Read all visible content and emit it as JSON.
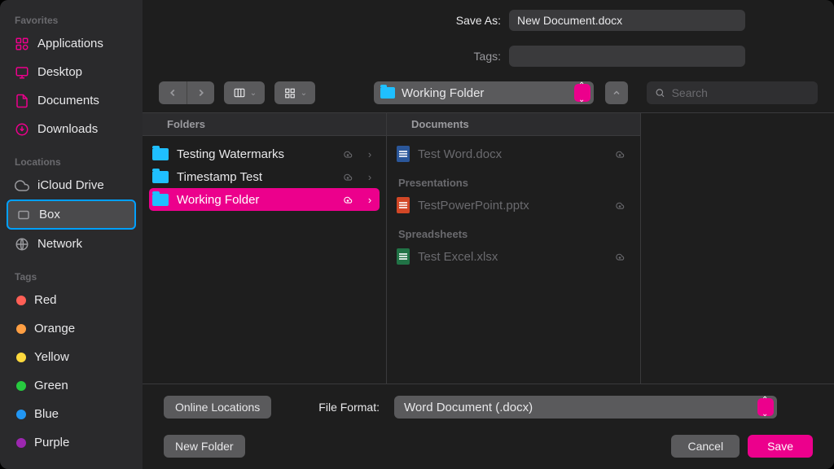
{
  "header": {
    "save_as_label": "Save As:",
    "filename": "New Document.docx",
    "tags_label": "Tags:",
    "tags_value": ""
  },
  "toolbar": {
    "location_folder": "Working Folder",
    "search_placeholder": "Search"
  },
  "sidebar": {
    "favorites_heading": "Favorites",
    "favorites": [
      {
        "label": "Applications",
        "icon": "apps"
      },
      {
        "label": "Desktop",
        "icon": "desktop"
      },
      {
        "label": "Documents",
        "icon": "document"
      },
      {
        "label": "Downloads",
        "icon": "download"
      }
    ],
    "locations_heading": "Locations",
    "locations": [
      {
        "label": "iCloud Drive",
        "icon": "cloud"
      },
      {
        "label": "Box",
        "icon": "box",
        "selected": true
      },
      {
        "label": "Network",
        "icon": "globe"
      }
    ],
    "tags_heading": "Tags",
    "tags": [
      {
        "label": "Red",
        "color": "#ff5f56"
      },
      {
        "label": "Orange",
        "color": "#ff9f43"
      },
      {
        "label": "Yellow",
        "color": "#ffd93d"
      },
      {
        "label": "Green",
        "color": "#27c93f"
      },
      {
        "label": "Blue",
        "color": "#2196f3"
      },
      {
        "label": "Purple",
        "color": "#9c27b0"
      }
    ]
  },
  "browser": {
    "col_a_heading": "Folders",
    "col_b_docs_heading": "Documents",
    "col_b_pres_heading": "Presentations",
    "col_b_spread_heading": "Spreadsheets",
    "folders": [
      {
        "label": "Testing Watermarks"
      },
      {
        "label": "Timestamp Test"
      },
      {
        "label": "Working Folder",
        "selected": true
      }
    ],
    "documents": [
      {
        "label": "Test Word.docx",
        "type": "word"
      }
    ],
    "presentations": [
      {
        "label": "TestPowerPoint.pptx",
        "type": "ppt"
      }
    ],
    "spreadsheets": [
      {
        "label": "Test Excel.xlsx",
        "type": "excel"
      }
    ]
  },
  "bottom": {
    "online_locations": "Online Locations",
    "file_format_label": "File Format:",
    "file_format_value": "Word Document (.docx)",
    "new_folder": "New Folder",
    "cancel": "Cancel",
    "save": "Save"
  }
}
